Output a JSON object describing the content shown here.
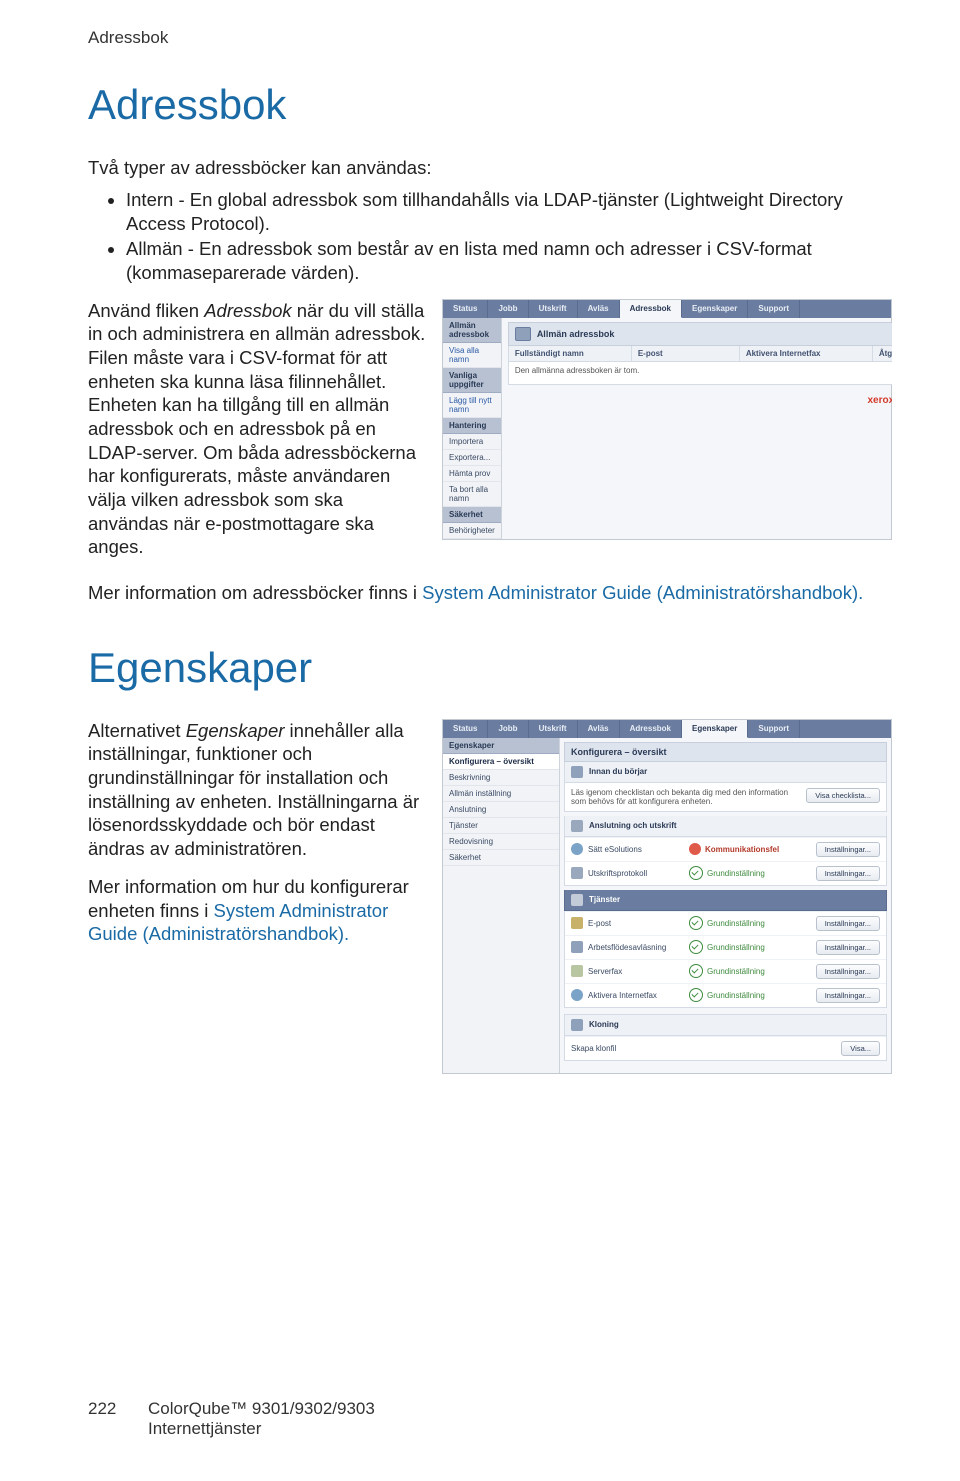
{
  "running_head": "Adressbok",
  "h1_adressbok": "Adressbok",
  "intro_para": "Två typer av adressböcker kan användas:",
  "bullets": [
    "Intern - En global adressbok som tillhandahålls via LDAP-tjänster (Lightweight Directory Access Protocol).",
    "Allmän - En adressbok som består av en lista med namn och adresser i CSV-format (kommaseparerade värden)."
  ],
  "wrap_para_1a": "Använd fliken ",
  "wrap_para_1b_italic": "Adressbok",
  "wrap_para_1c": " när du vill ställa in och administrera en allmän adressbok. Filen måste vara i CSV-format för att enheten ska kunna läsa filinnehållet. Enheten kan ha tillgång till en allmän adressbok och en adressbok på en LDAP-server. Om båda adressböckerna har konfigurerats, måste användaren välja vilken adressbok som ska användas när e-postmottagare ska anges.",
  "more_info_1_pre": "Mer information om adressböcker finns i ",
  "more_info_1_link": "System Administrator Guide (Administratörshandbok).",
  "h1_egenskaper": "Egenskaper",
  "egenskaper_para_a": "Alternativet ",
  "egenskaper_para_b_italic": "Egenskaper",
  "egenskaper_para_c": " innehåller alla inställningar, funktioner och grundinställningar för installation och inställning av enheten. Inställningarna är lösenordsskyddade och bör endast ändras av administratören.",
  "more_info_2_pre": "Mer information om hur du konfigurerar enheten finns i ",
  "more_info_2_link": "System Administrator Guide (Administratörshandbok).",
  "footer_page": "222",
  "footer_line1": "ColorQube™ 9301/9302/9303",
  "footer_line2": "Internettjänster",
  "tabs": [
    "Status",
    "Jobb",
    "Utskrift",
    "Avläs",
    "Adressbok",
    "Egenskaper",
    "Support"
  ],
  "shot1": {
    "side_hdr1": "Allmän adressbok",
    "side_row1": "Visa alla namn",
    "side_hdr2": "Vanliga uppgifter",
    "side_row2": "Lägg till nytt namn",
    "side_hdr3": "Hantering",
    "side_rows3": [
      "Importera",
      "Exportera...",
      "Hämta prov",
      "Ta bort alla namn"
    ],
    "side_hdr4": "Säkerhet",
    "side_row4": "Behörigheter",
    "main_title": "Allmän adressbok",
    "cols": [
      "Fullständigt namn",
      "E-post",
      "Aktivera Internetfax",
      "Åtgärder"
    ],
    "empty": "Den allmänna adressboken är tom.",
    "logo": "xerox"
  },
  "shot2": {
    "side_hdr": "Egenskaper",
    "side_rows": [
      "Konfigurera – översikt",
      "Beskrivning",
      "Allmän inställning",
      "Anslutning",
      "Tjänster",
      "Redovisning",
      "Säkerhet"
    ],
    "main_title": "Konfigurera – översikt",
    "block1_hdr": "Innan du börjar",
    "block1_desc": "Läs igenom checklistan och bekanta dig med den information som behövs för att konfigurera enheten.",
    "block1_btn": "Visa checklista...",
    "block2_hdr": "Anslutning och utskrift",
    "row_a_lab": "Sätt eSolutions",
    "row_a_stat": "Kommunikationsfel",
    "row_a_btn": "Inställningar...",
    "row_b_lab": "Utskriftsprotokoll",
    "row_b_stat": "Grundinställning",
    "row_b_btn": "Inställningar...",
    "bar_tjanster": "Tjänster",
    "svc": [
      {
        "lab": "E-post",
        "stat": "Grundinställning",
        "btn": "Inställningar..."
      },
      {
        "lab": "Arbetsflödesavläsning",
        "stat": "Grundinställning",
        "btn": "Inställningar..."
      },
      {
        "lab": "Serverfax",
        "stat": "Grundinställning",
        "btn": "Inställningar..."
      },
      {
        "lab": "Aktivera Internetfax",
        "stat": "Grundinställning",
        "btn": "Inställningar..."
      }
    ],
    "klon_hdr": "Kloning",
    "klon_row": "Skapa klonfil",
    "klon_btn": "Visa..."
  }
}
